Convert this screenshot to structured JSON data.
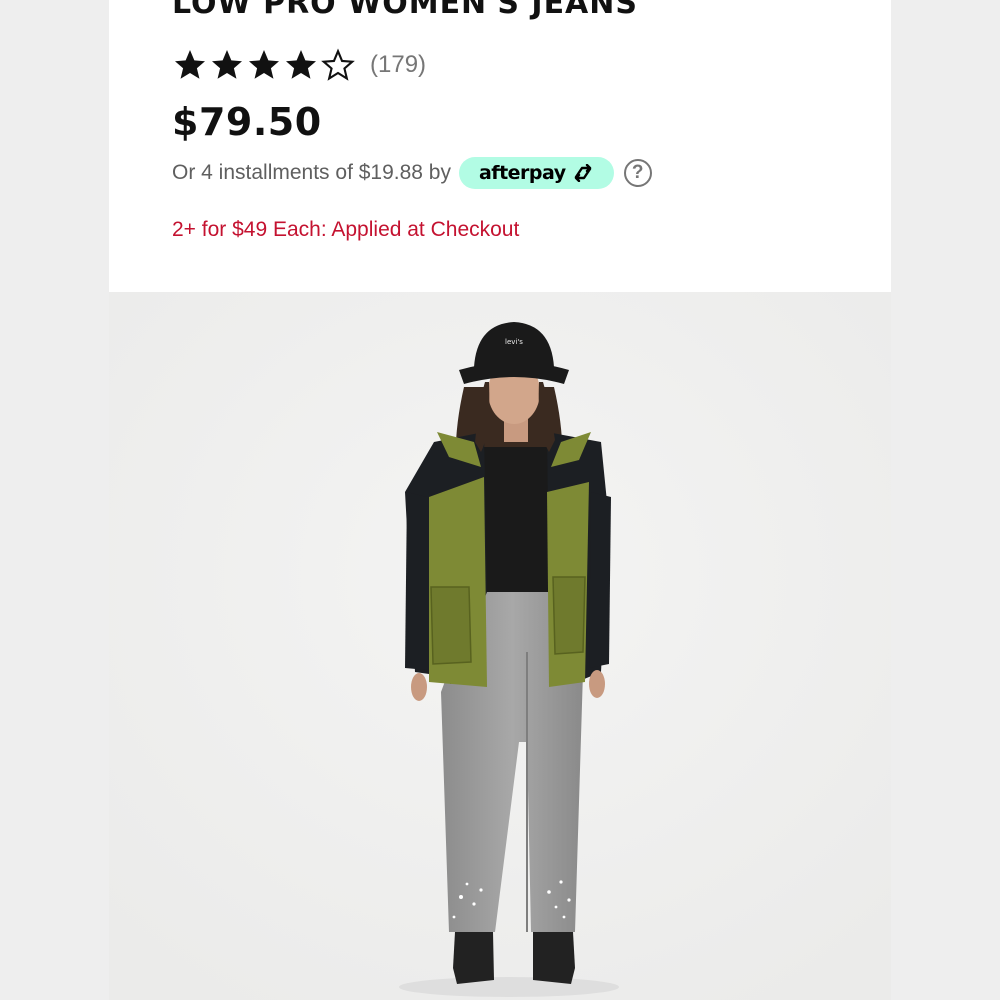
{
  "product": {
    "title": "LOW PRO WOMEN'S JEANS",
    "rating_stars": 4,
    "rating_max": 5,
    "review_count": "(179)",
    "price": "$79.50",
    "installments_text": "Or 4 installments of $19.88 by",
    "afterpay_label": "afterpay",
    "help_icon": "?",
    "promo_text": "2+ for $49 Each: Applied at Checkout",
    "hat_logo": "levi's"
  },
  "colors": {
    "promo": "#c41230",
    "afterpay_bg": "#b2fce4",
    "jacket_olive": "#7e8a35",
    "jeans_gray": "#9a9a9a"
  }
}
